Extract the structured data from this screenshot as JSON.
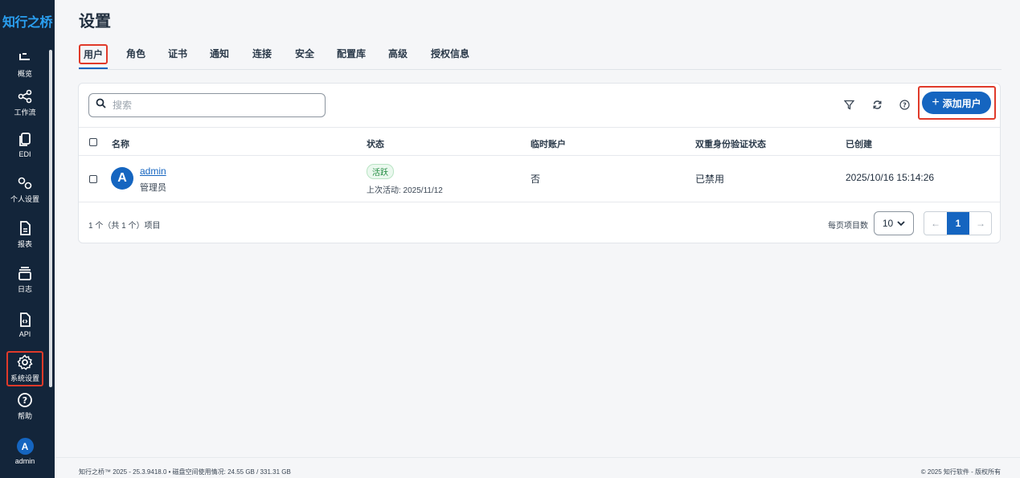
{
  "app": {
    "logo": "知行之桥"
  },
  "sidebar": {
    "items": [
      {
        "label": "概览",
        "icon": "overview-icon"
      },
      {
        "label": "工作流",
        "icon": "workflow-icon"
      },
      {
        "label": "EDI",
        "icon": "edi-icon"
      },
      {
        "label": "个人设置",
        "icon": "personal-settings-icon"
      },
      {
        "label": "报表",
        "icon": "report-icon"
      },
      {
        "label": "日志",
        "icon": "log-icon"
      },
      {
        "label": "API",
        "icon": "api-icon"
      },
      {
        "label": "系统设置",
        "icon": "gear-icon",
        "active": true
      },
      {
        "label": "帮助",
        "icon": "help-icon"
      },
      {
        "label": "admin",
        "icon": "avatar",
        "avatar_letter": "A"
      }
    ]
  },
  "page": {
    "title": "设置",
    "tabs": [
      "用户",
      "角色",
      "证书",
      "通知",
      "连接",
      "安全",
      "配置库",
      "高级",
      "授权信息"
    ],
    "active_tab": "用户"
  },
  "toolbar": {
    "search_placeholder": "搜索",
    "add_user_label": "添加用户"
  },
  "table": {
    "headers": {
      "name": "名称",
      "status": "状态",
      "temp": "临时账户",
      "mfa": "双重身份验证状态",
      "created": "已创建"
    },
    "rows": [
      {
        "avatar": "A",
        "name": "admin",
        "role": "管理员",
        "status_badge": "活跃",
        "last_active": "上次活动:  2025/11/12",
        "temp": "否",
        "mfa": "已禁用",
        "created": "2025/10/16 15:14:26"
      }
    ]
  },
  "pagination": {
    "count_text": "1 个（共 1 个）项目",
    "per_page_label": "每页项目数",
    "per_page_value": "10",
    "current_page": "1"
  },
  "status_bar": {
    "left": "知行之桥™ 2025 - 25.3.9418.0  •  磁盘空间使用情况:   24.55 GB / 331.31 GB",
    "right": "© 2025 知行软件 - 版权所有"
  },
  "colors": {
    "sidebar_bg": "#13253a",
    "accent": "#1565c0",
    "highlight": "#e03a2a",
    "active_badge": "#1f8a3f"
  }
}
